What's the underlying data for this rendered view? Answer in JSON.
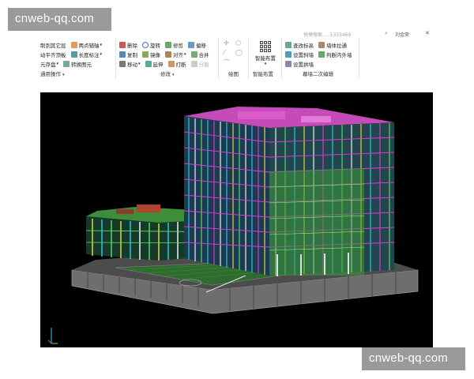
{
  "watermarks": {
    "top": "cnweb-qq.com",
    "bottom": "cnweb-qq.com"
  },
  "search": {
    "placeholder": "快捷搜索..., 1315469",
    "user_name": "刘金荣",
    "close_glyph": "✕"
  },
  "ribbon": {
    "general": {
      "rows": [
        [
          "制到其它层",
          "两点辅轴"
        ],
        [
          "动平齐顶板",
          "长度标注"
        ],
        [
          "元存盘",
          "转换图元"
        ]
      ],
      "label": "通用操作"
    },
    "modify": {
      "rows": [
        [
          "删除",
          "旋转",
          "修剪",
          "偏移"
        ],
        [
          "复制",
          "镜像",
          "对齐",
          "合并"
        ],
        [
          "移动",
          "延伸",
          "打断",
          "分割"
        ]
      ],
      "label": "修改"
    },
    "draw": {
      "label": "绘图"
    },
    "smart": {
      "button_label": "智能布置",
      "label": "智能布置"
    },
    "curtain": {
      "rows": [
        [
          "查改标高",
          "墙体拉通"
        ],
        [
          "设置斜墙",
          "判断内外墙"
        ],
        [
          "设置拱墙"
        ]
      ],
      "label": "幕墙二次编辑"
    }
  },
  "viewport": {
    "description_icon": "3d-building-model"
  },
  "colors": {
    "viewport_bg": "#000000",
    "model_magenta": "#e23bd8",
    "model_green": "#5fe36a",
    "model_cyan": "#37c9e8",
    "model_yellow": "#f1e04a",
    "base_gray": "#7a7a7a",
    "ground_green": "#2f6b2f"
  }
}
